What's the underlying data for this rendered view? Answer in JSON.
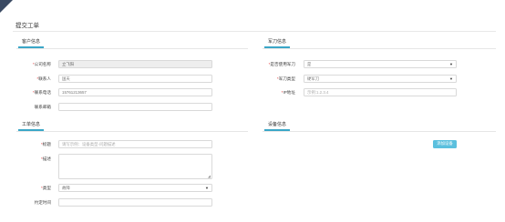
{
  "page": {
    "title": "提交工单"
  },
  "customer": {
    "heading": "客户信息",
    "company_label": "公司名称",
    "company_value": "立飞阳",
    "contact_label": "联系人",
    "contact_value": "国天",
    "phone_label": "联系电话",
    "phone_value": "15761213657",
    "email_label": "联系邮箱",
    "email_value": ""
  },
  "knife": {
    "heading": "军刀信息",
    "use_label": "是否使用军刀",
    "use_value": "是",
    "type_label": "军刀类型",
    "type_value": "硬军刀",
    "ip_label": "IP地址",
    "ip_placeholder": "示例:1.2.3.4"
  },
  "ticket": {
    "heading": "工单信息",
    "title_label": "标题",
    "title_placeholder": "请写示例：设备类型-问题描述",
    "desc_label": "描述",
    "type_label": "类型",
    "type_value": "故障",
    "time_label": "约定时间",
    "time_value": ""
  },
  "device": {
    "heading": "设备信息",
    "add_button": "添加设备"
  },
  "colors": {
    "accent": "#3aa6c7",
    "button": "#5bc0de",
    "required": "#e03b3b"
  }
}
